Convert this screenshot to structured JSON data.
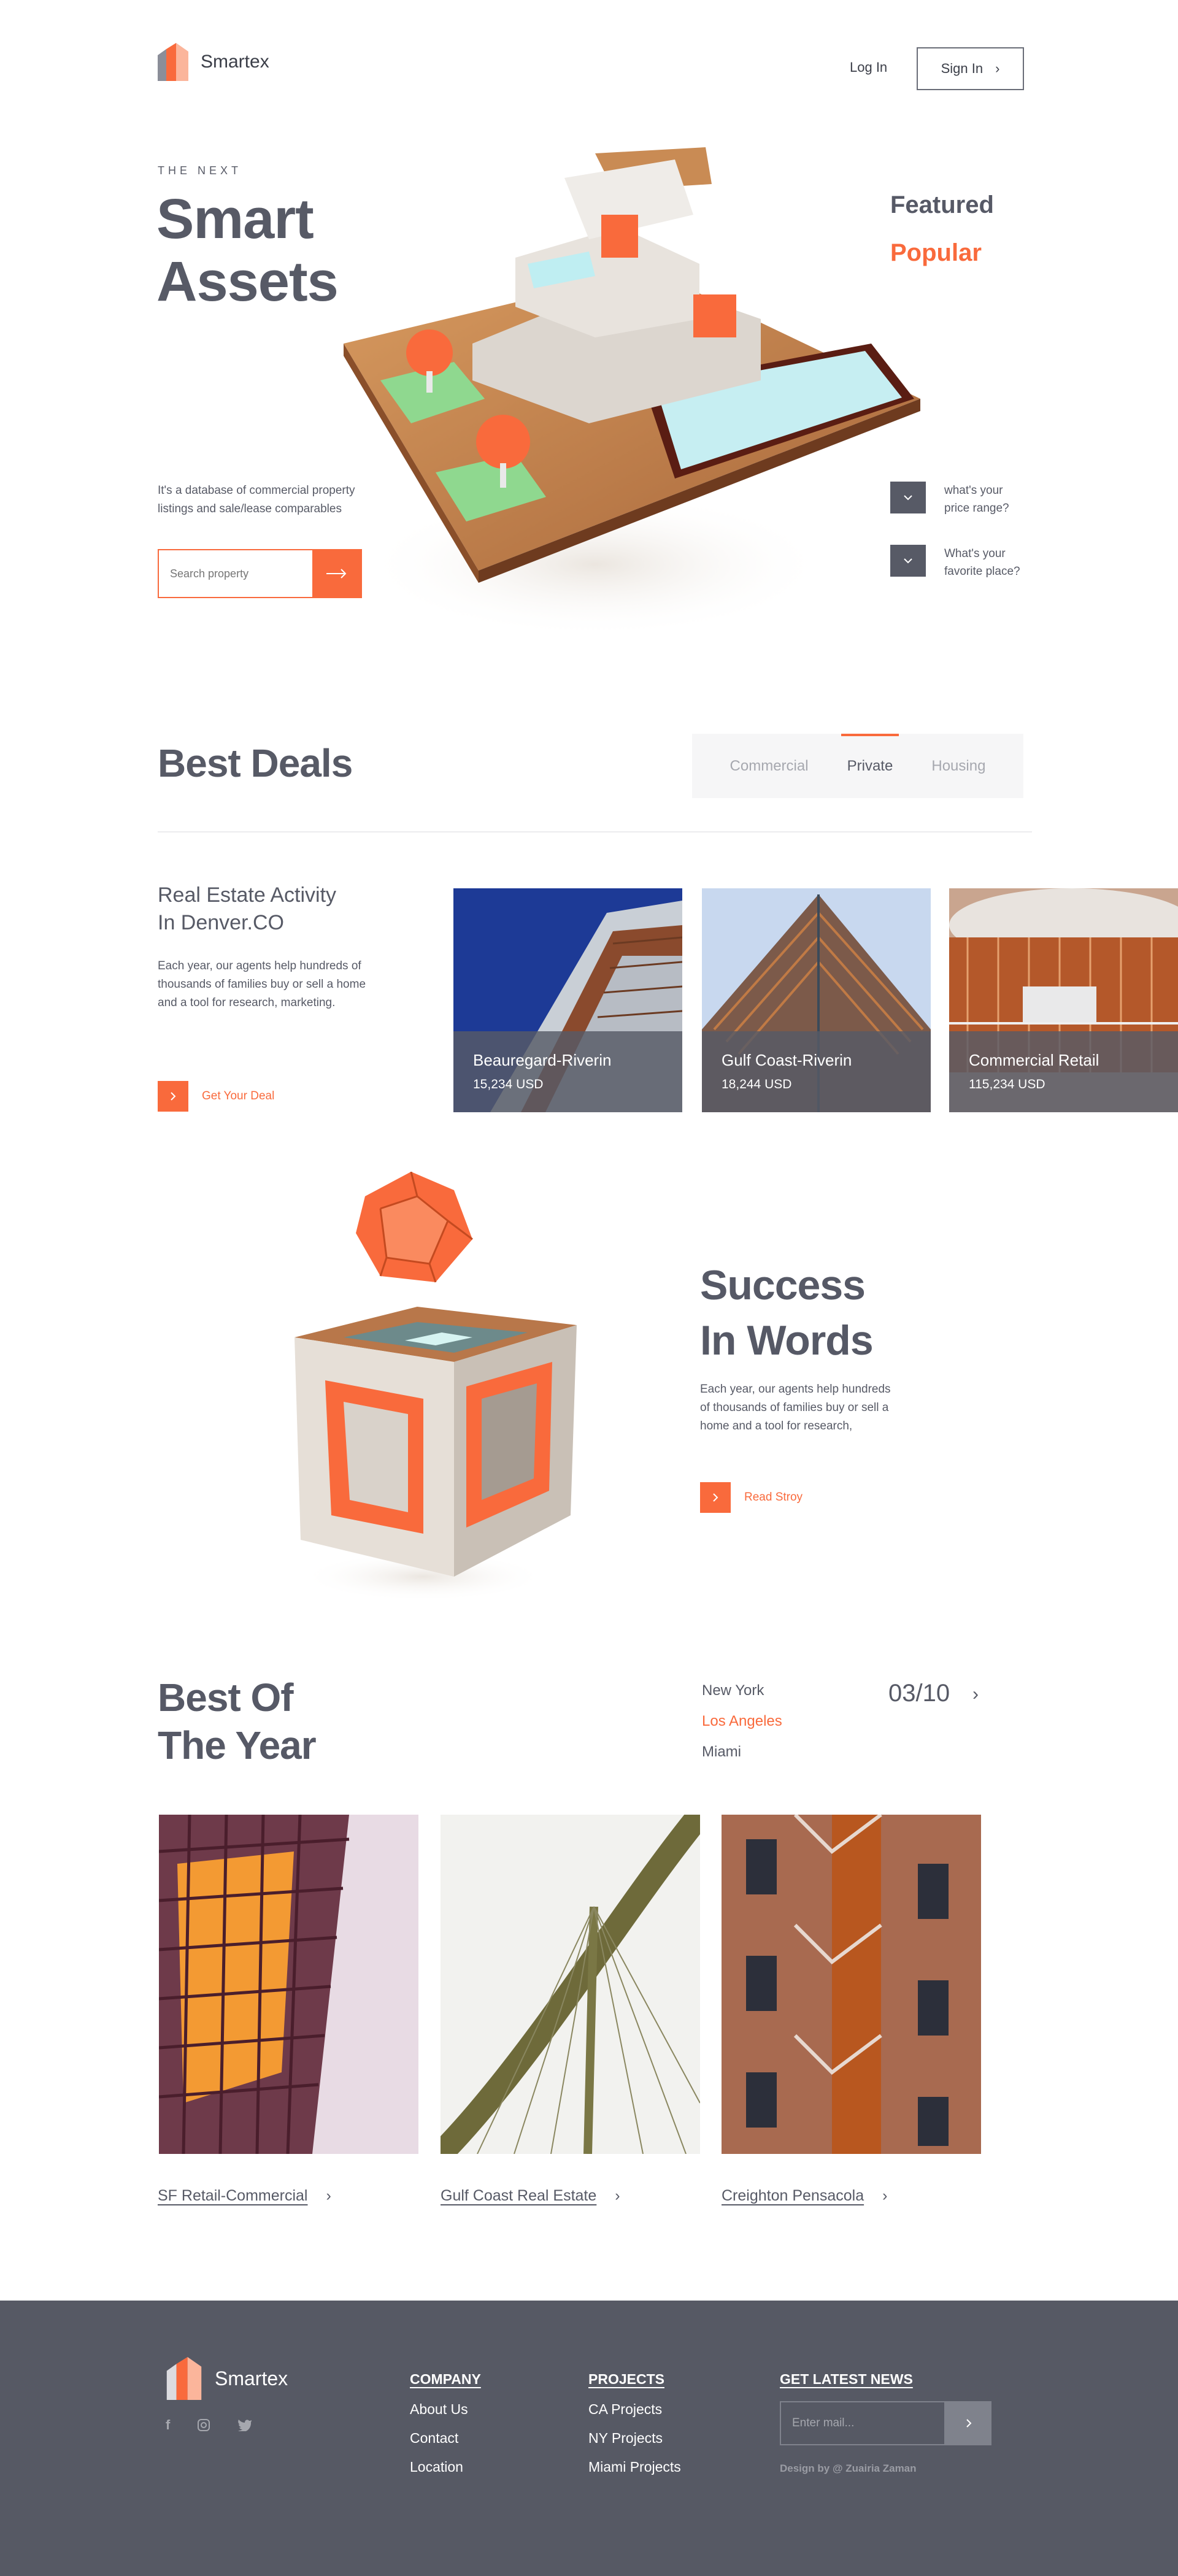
{
  "brand": {
    "name": "Smartex",
    "accent": "#f96a3c",
    "dark": "#575a66"
  },
  "header": {
    "login_label": "Log In",
    "signin_label": "Sign In"
  },
  "hero": {
    "eyebrow": "THE NEXT",
    "title_line1": "Smart",
    "title_line2": "Assets",
    "description_line1": "It's a database of commercial property",
    "description_line2": "listings and sale/lease comparables",
    "search_placeholder": "Search property",
    "side_tabs": [
      "Featured",
      "Popular"
    ],
    "faq": [
      {
        "line1": "what's your",
        "line2": "price range?"
      },
      {
        "line1": "What's your",
        "line2": "favorite place?"
      }
    ]
  },
  "best_deals": {
    "title": "Best Deals",
    "tabs": [
      "Commercial",
      "Private",
      "Housing"
    ],
    "active_tab": "Private",
    "activity_title_line1": "Real Estate Activity",
    "activity_title_line2": "In Denver.CO",
    "activity_text_line1": "Each year, our agents help hundreds of",
    "activity_text_line2": "thousands of families buy or sell a home",
    "activity_text_line3": "and a tool for research, marketing.",
    "cta_label": "Get Your Deal",
    "cards": [
      {
        "title": "Beauregard-Riverin",
        "price": "15,234 USD"
      },
      {
        "title": "Gulf Coast-Riverin",
        "price": "18,244 USD"
      },
      {
        "title": "Commercial Retail",
        "price": "115,234 USD"
      }
    ]
  },
  "success": {
    "title_line1": "Success",
    "title_line2": "In Words",
    "text_line1": "Each year, our agents help hundreds",
    "text_line2": "of thousands of families buy or sell a",
    "text_line3": "home and a tool for research,",
    "cta_label": "Read Stroy"
  },
  "best_of_year": {
    "title_line1": "Best Of",
    "title_line2": "The Year",
    "cities": [
      "New York",
      "Los Angeles",
      "Miami"
    ],
    "active_city": "Los Angeles",
    "counter": "03/10",
    "items": [
      "SF Retail-Commercial",
      "Gulf Coast Real Estate",
      "Creighton Pensacola"
    ]
  },
  "footer": {
    "brand": "Smartex",
    "social_icons": [
      "facebook-icon",
      "instagram-icon",
      "twitter-icon"
    ],
    "company_title": "COMPANY",
    "company_links": [
      "About Us",
      "Contact",
      "Location"
    ],
    "projects_title": "PROJECTS",
    "projects_links": [
      "CA Projects",
      "NY Projects",
      "Miami Projects"
    ],
    "news_title": "GET LATEST NEWS",
    "email_placeholder": "Enter mail...",
    "credit": "Design by @ Zuairia Zaman"
  }
}
